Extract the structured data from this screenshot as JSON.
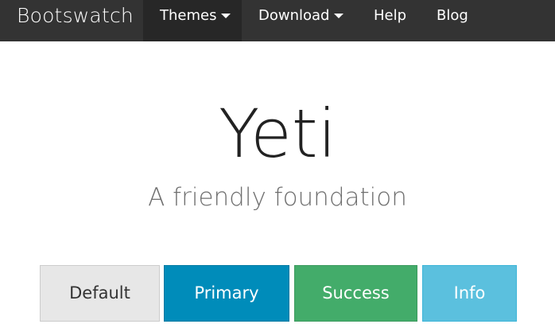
{
  "navbar": {
    "brand": "Bootswatch",
    "items": [
      {
        "label": "Themes",
        "has_caret": true,
        "active": true
      },
      {
        "label": "Download",
        "has_caret": true,
        "active": false
      },
      {
        "label": "Help",
        "has_caret": false,
        "active": false
      },
      {
        "label": "Blog",
        "has_caret": false,
        "active": false
      }
    ],
    "background": "#333333"
  },
  "hero": {
    "title": "Yeti",
    "subtitle": "A friendly foundation"
  },
  "buttons": [
    {
      "label": "Default",
      "color": "#e7e7e7"
    },
    {
      "label": "Primary",
      "color": "#008cba"
    },
    {
      "label": "Success",
      "color": "#43ac6a"
    },
    {
      "label": "Info",
      "color": "#5bc0de"
    }
  ]
}
